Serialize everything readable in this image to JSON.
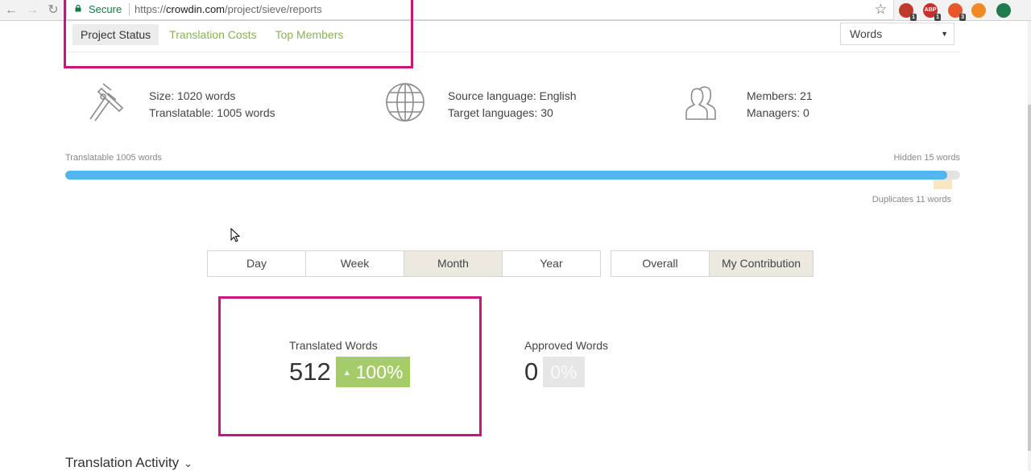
{
  "browser": {
    "secure_label": "Secure",
    "url_prefix": "https://",
    "url_host": "crowdin.com",
    "url_path": "/project/sieve/reports",
    "extensions": [
      {
        "name": "ublock-icon",
        "badge": "1",
        "color": "#c0392b"
      },
      {
        "name": "adblock-plus-icon",
        "label": "ABP",
        "badge": "1",
        "color": "#c9302c"
      },
      {
        "name": "extension-icon",
        "badge": "3",
        "color": "#e8562a"
      },
      {
        "name": "fox-extension-icon",
        "badge": "",
        "color": "#f08a24"
      },
      {
        "name": "checkmark-extension-icon",
        "badge": "",
        "color": "#1f7a4d"
      }
    ]
  },
  "tabs": [
    {
      "label": "Project Status",
      "active": true
    },
    {
      "label": "Translation Costs",
      "active": false
    },
    {
      "label": "Top Members",
      "active": false
    }
  ],
  "units_select": {
    "value": "Words"
  },
  "stats": {
    "size": "Size: 1020 words",
    "translatable": "Translatable: 1005 words",
    "source_language": "Source language: English",
    "target_languages": "Target languages: 30",
    "members": "Members: 21",
    "managers": "Managers: 0"
  },
  "progress": {
    "translatable_label": "Translatable 1005 words",
    "hidden_label": "Hidden 15 words",
    "duplicates_label": "Duplicates 11 words",
    "translatable_fraction": 0.9855
  },
  "period_buttons": [
    {
      "label": "Day",
      "active": false
    },
    {
      "label": "Week",
      "active": false
    },
    {
      "label": "Month",
      "active": true
    },
    {
      "label": "Year",
      "active": false
    }
  ],
  "scope_buttons": [
    {
      "label": "Overall",
      "active": false
    },
    {
      "label": "My Contribution",
      "active": true
    }
  ],
  "metrics": {
    "translated": {
      "label": "Translated Words",
      "value": "512",
      "change": "100%"
    },
    "approved": {
      "label": "Approved Words",
      "value": "0",
      "change": "0%"
    }
  },
  "section_title": "Translation Activity",
  "colors": {
    "accent_green": "#8db256",
    "badge_green": "#a6cc6a",
    "progress_blue": "#52b6f0",
    "highlight_magenta": "#c8167c"
  }
}
